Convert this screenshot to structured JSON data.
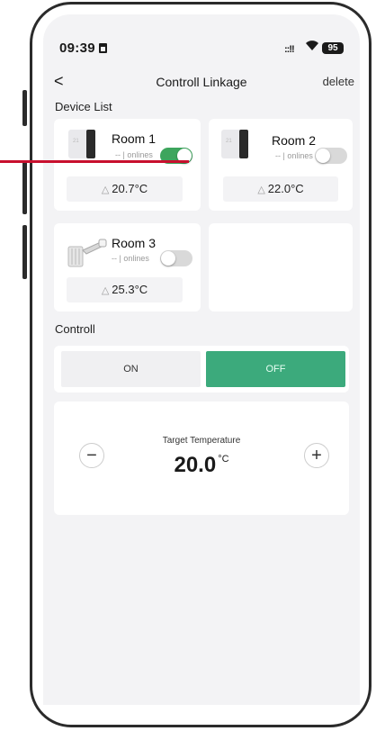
{
  "status_bar": {
    "time": "09:39",
    "signal": "::!!",
    "wifi": "◉",
    "battery": "95"
  },
  "nav": {
    "back": "<",
    "title": "Controll Linkage",
    "delete": "delete"
  },
  "device_list": {
    "heading": "Device List",
    "rooms": [
      {
        "name": "Room 1",
        "status": "-- | onlines",
        "on": true,
        "temperature": "20.7°C",
        "device": "thermostat"
      },
      {
        "name": "Room 2",
        "status": "-- | onlines",
        "on": false,
        "temperature": "22.0°C",
        "device": "thermostat"
      },
      {
        "name": "Room 3",
        "status": "-- | onlines",
        "on": false,
        "temperature": "25.3°C",
        "device": "radiator-valve"
      }
    ]
  },
  "control": {
    "heading": "Controll",
    "on_label": "ON",
    "off_label": "OFF",
    "selected": "OFF"
  },
  "target": {
    "label": "Target Temperature",
    "value": "20.0",
    "unit": "°C",
    "minus": "−",
    "plus": "+"
  },
  "colors": {
    "accent": "#3caa7c",
    "toggle_on": "#3da55d",
    "annotation_line": "#c8102e"
  }
}
